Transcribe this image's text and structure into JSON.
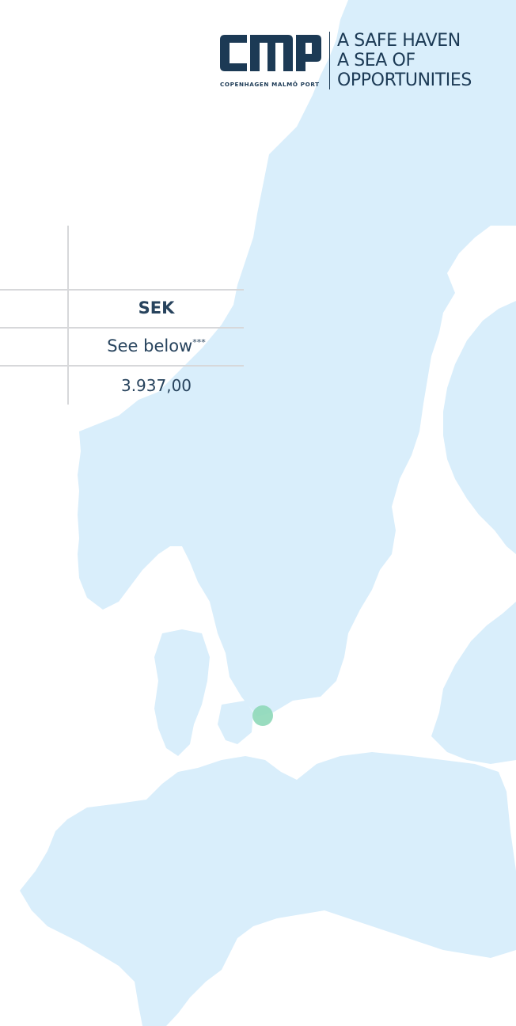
{
  "brand": {
    "logo_text": "CMP",
    "subtitle": "COPENHAGEN MALMÖ PORT",
    "tagline": [
      "A SAFE HAVEN",
      "A SEA OF",
      "OPPORTUNITIES"
    ],
    "color": "#1c3a55"
  },
  "table": {
    "currency_header": "SEK",
    "rows": [
      {
        "value": "See below",
        "footnote": "***"
      },
      {
        "value": "3.937,00",
        "footnote": ""
      }
    ],
    "line_color": "#d7d8da"
  },
  "map": {
    "land_color": "#d9eefb",
    "marker_color": "#8ed8b8"
  }
}
